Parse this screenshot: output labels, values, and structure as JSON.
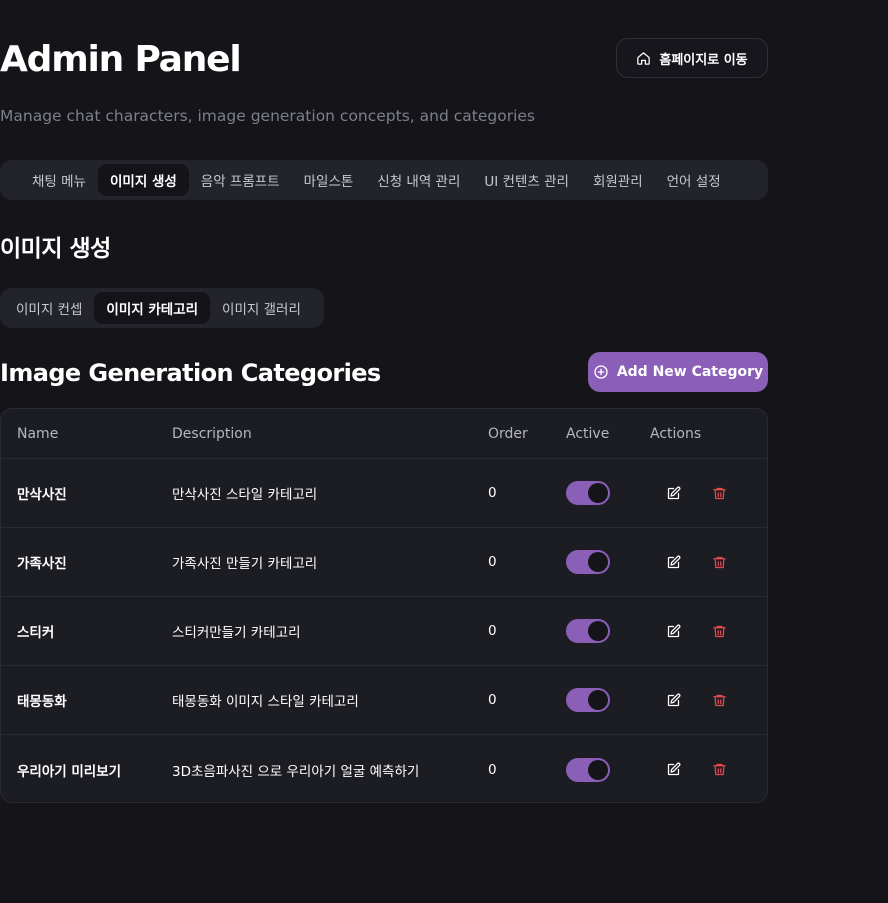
{
  "header": {
    "title": "Admin Panel",
    "subtitle": "Manage chat characters, image generation concepts, and categories",
    "home_button": "홈페이지로 이동"
  },
  "main_tabs": [
    {
      "label": "채팅 메뉴",
      "active": false
    },
    {
      "label": "이미지 생성",
      "active": true
    },
    {
      "label": "음악 프롬프트",
      "active": false
    },
    {
      "label": "마일스톤",
      "active": false
    },
    {
      "label": "신청 내역 관리",
      "active": false
    },
    {
      "label": "UI 컨텐츠 관리",
      "active": false
    },
    {
      "label": "회원관리",
      "active": false
    },
    {
      "label": "언어 설정",
      "active": false
    }
  ],
  "section_title": "이미지 생성",
  "sub_tabs": [
    {
      "label": "이미지 컨셉",
      "active": false
    },
    {
      "label": "이미지 카테고리",
      "active": true
    },
    {
      "label": "이미지 갤러리",
      "active": false
    }
  ],
  "categories": {
    "title": "Image Generation Categories",
    "add_button": "Add New Category",
    "columns": {
      "name": "Name",
      "description": "Description",
      "order": "Order",
      "active": "Active",
      "actions": "Actions"
    },
    "rows": [
      {
        "name": "만삭사진",
        "description": "만삭사진 스타일 카테고리",
        "order": "0",
        "active": true
      },
      {
        "name": "가족사진",
        "description": "가족사진 만들기 카테고리",
        "order": "0",
        "active": true
      },
      {
        "name": "스티커",
        "description": "스티커만들기 카테고리",
        "order": "0",
        "active": true
      },
      {
        "name": "태몽동화",
        "description": "태몽동화 이미지 스타일 카테고리",
        "order": "0",
        "active": true
      },
      {
        "name": "우리아기 미리보기",
        "description": "3D초음파사진 으로 우리아기 얼굴 예측하기",
        "order": "0",
        "active": true
      }
    ]
  },
  "colors": {
    "background": "#141419",
    "accent": "#8b5fb8",
    "danger": "#e5484d"
  },
  "icons": {
    "home": "home-icon",
    "add": "plus-circle-icon",
    "edit": "edit-icon",
    "delete": "trash-icon"
  }
}
